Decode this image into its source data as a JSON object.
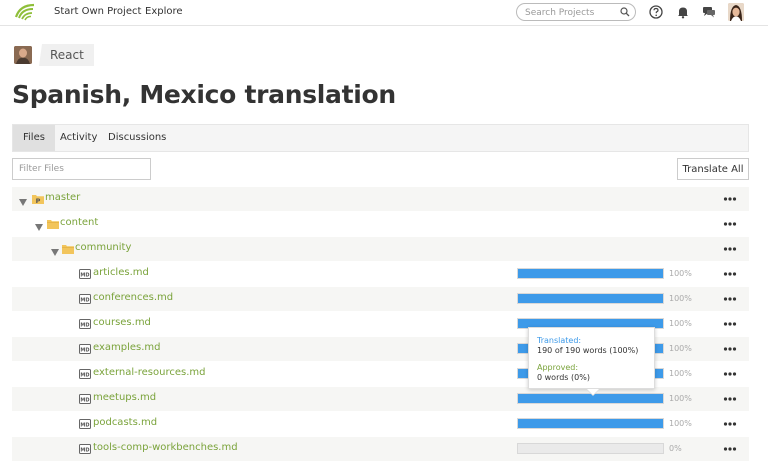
{
  "header": {
    "nav": [
      "Start Own Project",
      "Explore"
    ],
    "search_placeholder": "Search Projects",
    "icons": [
      "help-icon",
      "bell-icon",
      "chat-icon",
      "user-avatar"
    ]
  },
  "breadcrumb": {
    "project": "React"
  },
  "page_title": "Spanish, Mexico translation",
  "tabs": [
    "Files",
    "Activity",
    "Discussions"
  ],
  "active_tab": "Files",
  "filter_placeholder": "Filter Files",
  "translate_all_label": "Translate All",
  "tree": [
    {
      "name": "master",
      "type": "branch",
      "depth": 0
    },
    {
      "name": "content",
      "type": "folder",
      "depth": 1
    },
    {
      "name": "community",
      "type": "folder",
      "depth": 2
    },
    {
      "name": "articles.md",
      "type": "file",
      "progress": 100,
      "pct_label": "100%"
    },
    {
      "name": "conferences.md",
      "type": "file",
      "progress": 100,
      "pct_label": "100%"
    },
    {
      "name": "courses.md",
      "type": "file",
      "progress": 100,
      "pct_label": "100%"
    },
    {
      "name": "examples.md",
      "type": "file",
      "progress": 100,
      "pct_label": "100%"
    },
    {
      "name": "external-resources.md",
      "type": "file",
      "progress": 100,
      "pct_label": "100%"
    },
    {
      "name": "meetups.md",
      "type": "file",
      "progress": 100,
      "pct_label": "100%"
    },
    {
      "name": "podcasts.md",
      "type": "file",
      "progress": 100,
      "pct_label": "100%"
    },
    {
      "name": "tools-comp-workbenches.md",
      "type": "file",
      "progress": 0,
      "pct_label": "0%"
    }
  ],
  "tooltip": {
    "translated_label": "Translated:",
    "translated_value": "190 of 190 words (100%)",
    "approved_label": "Approved:",
    "approved_value": "0 words (0%)"
  },
  "colors": {
    "accent_blue": "#3d9ae9",
    "link_green": "#7aa33b"
  }
}
